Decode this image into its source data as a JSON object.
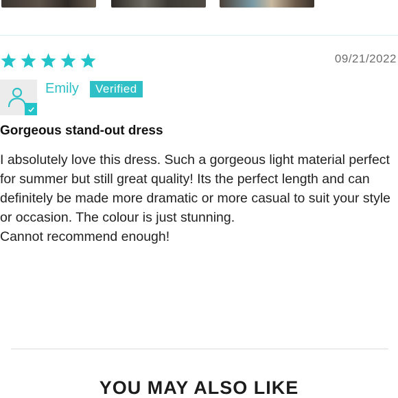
{
  "review": {
    "rating": 5,
    "max_rating": 5,
    "date": "09/21/2022",
    "author": "Emily",
    "badge": "Verified",
    "title": "Gorgeous stand-out dress",
    "body": "I absolutely love this dress. Such a gorgeous light material perfect for summer but still great quality! Its the perfect length and can definitely be made more dramatic or more casual to suit your style or occasion. The colour is just stunning.",
    "body_line2": "Cannot recommend enough!"
  },
  "section": {
    "heading": "YOU MAY ALSO LIKE"
  },
  "icons": {
    "star": "star-icon",
    "avatar": "user-icon",
    "check": "check-icon"
  },
  "colors": {
    "accent": "#2ec0c6",
    "star": "#22c3c9",
    "date": "#6e6e6e"
  }
}
